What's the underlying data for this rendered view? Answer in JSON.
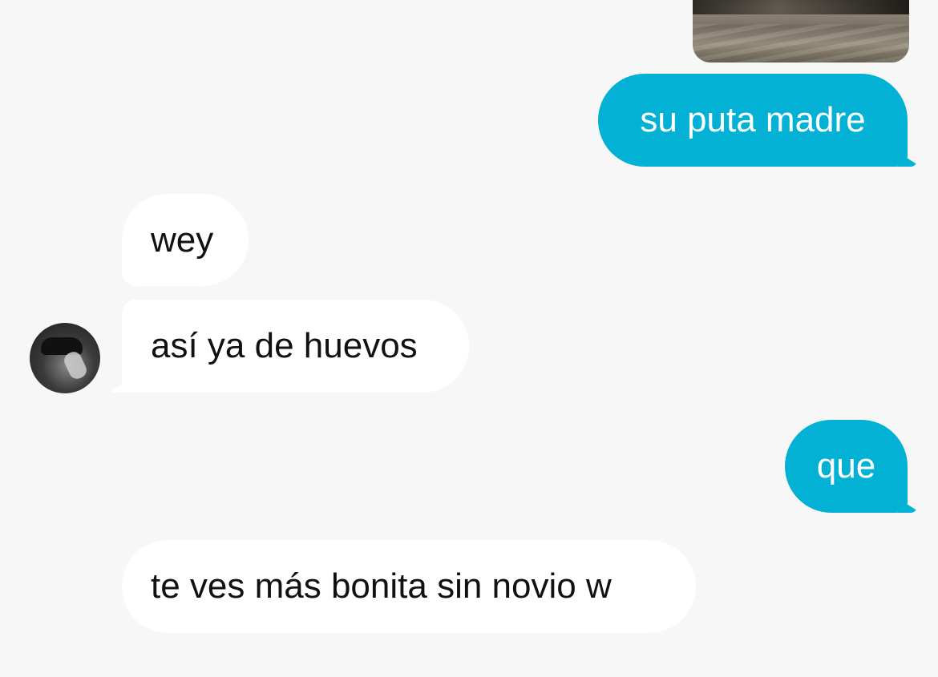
{
  "conversation": {
    "media_message": {
      "icon": "photo-thumbnail"
    },
    "messages": [
      {
        "id": "m1",
        "direction": "outgoing",
        "text": "su puta madre"
      },
      {
        "id": "m2",
        "direction": "incoming",
        "text": "wey"
      },
      {
        "id": "m3",
        "direction": "incoming",
        "text": "así ya de huevos"
      },
      {
        "id": "m4",
        "direction": "outgoing",
        "text": "que"
      },
      {
        "id": "m5",
        "direction": "incoming",
        "text": "te ves más bonita sin novio w"
      }
    ],
    "contact": {
      "avatar_icon": "profile-photo"
    }
  },
  "colors": {
    "outgoing_bubble": "#02b1d4",
    "incoming_bubble": "#ffffff",
    "background": "#f7f7f7"
  }
}
